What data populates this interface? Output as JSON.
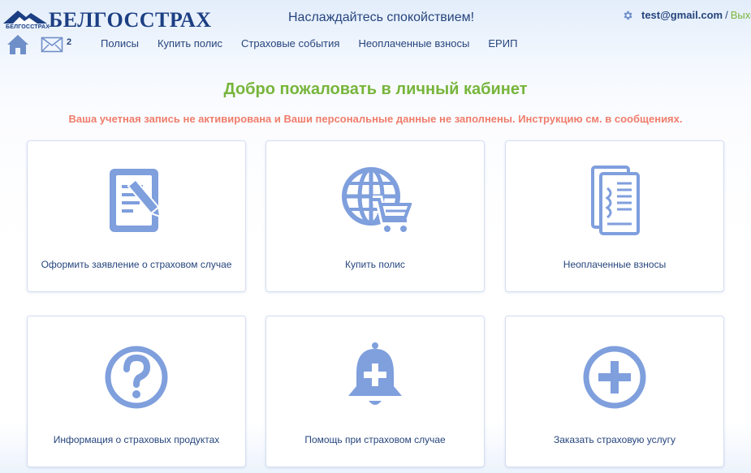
{
  "brand": {
    "name": "БЕЛГОССТРАХ",
    "small_mark": "БЕЛГОССТРАХ"
  },
  "header": {
    "tagline": "Наслаждайтесь спокойствием!",
    "account": {
      "email": "test@gmail.com",
      "separator": "/",
      "logout": "Выход"
    },
    "mail_count": "2"
  },
  "nav": {
    "items": [
      {
        "label": "Полисы"
      },
      {
        "label": "Купить полис"
      },
      {
        "label": "Страховые события"
      },
      {
        "label": "Неоплаченные взносы"
      },
      {
        "label": "ЕРИП"
      }
    ]
  },
  "main": {
    "title": "Добро пожаловать в личный кабинет",
    "warning": "Ваша учетная запись не активирована и Ваши персональные данные не заполнены. Инструкцию см. в сообщениях.",
    "cards": [
      {
        "label": "Оформить заявление о страховом случае",
        "icon": "document-edit-icon"
      },
      {
        "label": "Купить полис",
        "icon": "globe-cart-icon"
      },
      {
        "label": "Неоплаченные взносы",
        "icon": "receipt-icon"
      },
      {
        "label": "Информация о страховых продуктах",
        "icon": "question-circle-icon"
      },
      {
        "label": "Помощь при страховом случае",
        "icon": "bell-plus-icon"
      },
      {
        "label": "Заказать страховую услугу",
        "icon": "plus-circle-icon"
      }
    ]
  },
  "colors": {
    "brand_blue": "#1c3f83",
    "icon_blue": "#7f9fdd",
    "accent_green": "#77b53b",
    "warning_red": "#ef7d6b"
  }
}
